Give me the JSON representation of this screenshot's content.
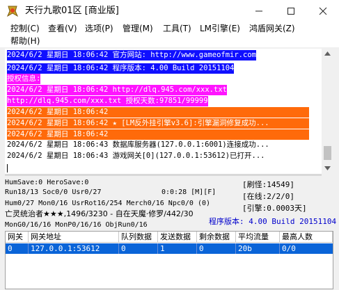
{
  "window": {
    "title": "天行九歌01区 [商业版]"
  },
  "menu": [
    "控制(C)",
    "查看(V)",
    "选项(P)",
    "管理(M)",
    "工具(T)",
    "LM引擎(E)",
    "鸿盾网关(Z)",
    "帮助(H)"
  ],
  "colors": {
    "blue_bg": "#1010ff",
    "magenta_bg": "#ff14ff",
    "orange_bg": "#ff6a0a",
    "orange_text": "#ff5a00",
    "stat_blue": "#0000cc"
  },
  "log": [
    {
      "text": "2024/6/2 星期日 18:06:42 官方网站: http://www.gameofmir.com",
      "style": "blue"
    },
    {
      "text": "2024/6/2 星期日 18:06:42 程序版本: 4.00 Build 20151104",
      "style": "blue"
    },
    {
      "text": "授权信息:",
      "style": "magenta"
    },
    {
      "text": "2024/6/2 星期日 18:06:42 http://dlq.945.com/xxx.txt",
      "style": "magenta"
    },
    {
      "text": "http://dlq.945.com/xxx.txt 授权天数:97851/99999",
      "style": "magenta"
    },
    {
      "text": "2024/6/2 星期日 18:06:42",
      "style": "orange"
    },
    {
      "text": "2024/6/2 星期日 18:06:42 ★ [LM反外挂引擎v3.6]:引擎漏洞修复成功...",
      "style": "orange"
    },
    {
      "text": "2024/6/2 星期日 18:06:42",
      "style": "orange"
    },
    {
      "text": "2024/6/2 星期日 18:06:43 数据库服务器(127.0.0.1:6001)连接成功...",
      "style": "plain"
    },
    {
      "text": "2024/6/2 星期日 18:06:43 游戏网关[0](127.0.0.1:53612)已打开...",
      "style": "plain"
    }
  ],
  "stats": {
    "line1": "HumSave:0 HeroSave:0",
    "line2a": "Run18/13 Soc0/0 Usr0/27",
    "line2b": "0:0:28 [M][F]",
    "line3": "Hum0/27 Mon0/16 UsrRot16/254 Merch0/16 Npc0/0 (0)",
    "line4": "亡灵统治者★★★,1496/3230 - 自在天魔·修罗/442/30",
    "line5": "MonG0/16/16 MonP0/16/16 ObjRun0/16",
    "refresh": "[刷怪:14549]",
    "online": "[在线:2/2/0]",
    "engine": "[引擎:0.0003天]",
    "version": "程序版本: 4.00 Build 20151104"
  },
  "table": {
    "headers": [
      "网关",
      "网关地址",
      "队列数据",
      "发送数据",
      "剩余数据",
      "平均流量",
      "最高人数"
    ],
    "rows": [
      [
        "0",
        "127.0.0.1:53612",
        "0",
        "1",
        "0",
        "20b",
        "0/0"
      ]
    ]
  }
}
